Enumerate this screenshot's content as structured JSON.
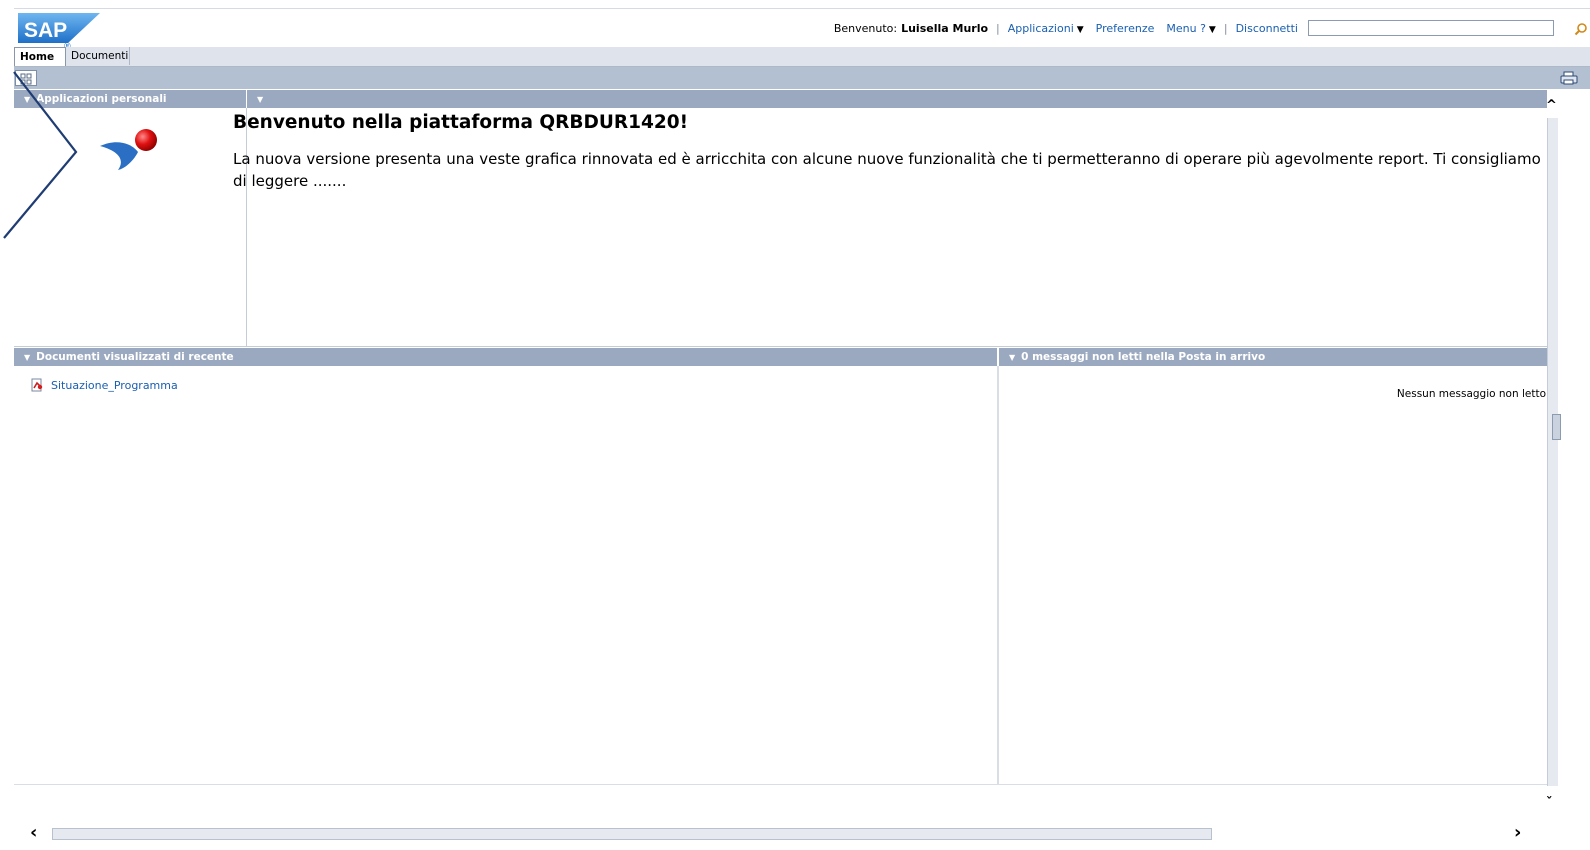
{
  "header": {
    "logo_text": "SAP",
    "welcome_label": "Benvenuto:",
    "user_name": "Luisella Murlo",
    "menu": {
      "applicazioni": "Applicazioni",
      "preferenze": "Preferenze",
      "menu_help": "Menu ?",
      "disconnetti": "Disconnetti"
    },
    "search_value": ""
  },
  "tabs": [
    {
      "label": "Home"
    },
    {
      "label": "Documenti"
    }
  ],
  "panels": {
    "applicazioni_personali": {
      "title": "Applicazioni personali"
    },
    "main": {
      "title": "",
      "heading": "Benvenuto nella piattaforma QRBDUR1420!",
      "body": "La nuova versione presenta una veste grafica rinnovata ed è arricchita con alcune nuove funzionalità che ti permetteranno di operare più agevolmente report. Ti consigliamo di leggere ......."
    },
    "recent_documents": {
      "title": "Documenti visualizzati di recente",
      "items": [
        {
          "label": "Situazione_Programma"
        }
      ]
    },
    "inbox": {
      "title": "0 messaggi non letti nella Posta in arrivo",
      "empty_text": "Nessun messaggio non letto"
    }
  },
  "colors": {
    "panel_header": "#9ba9c0",
    "link": "#1a5fb0",
    "toolbar": "#b3c0d2",
    "overlay_chevron": "#1f3d73"
  }
}
